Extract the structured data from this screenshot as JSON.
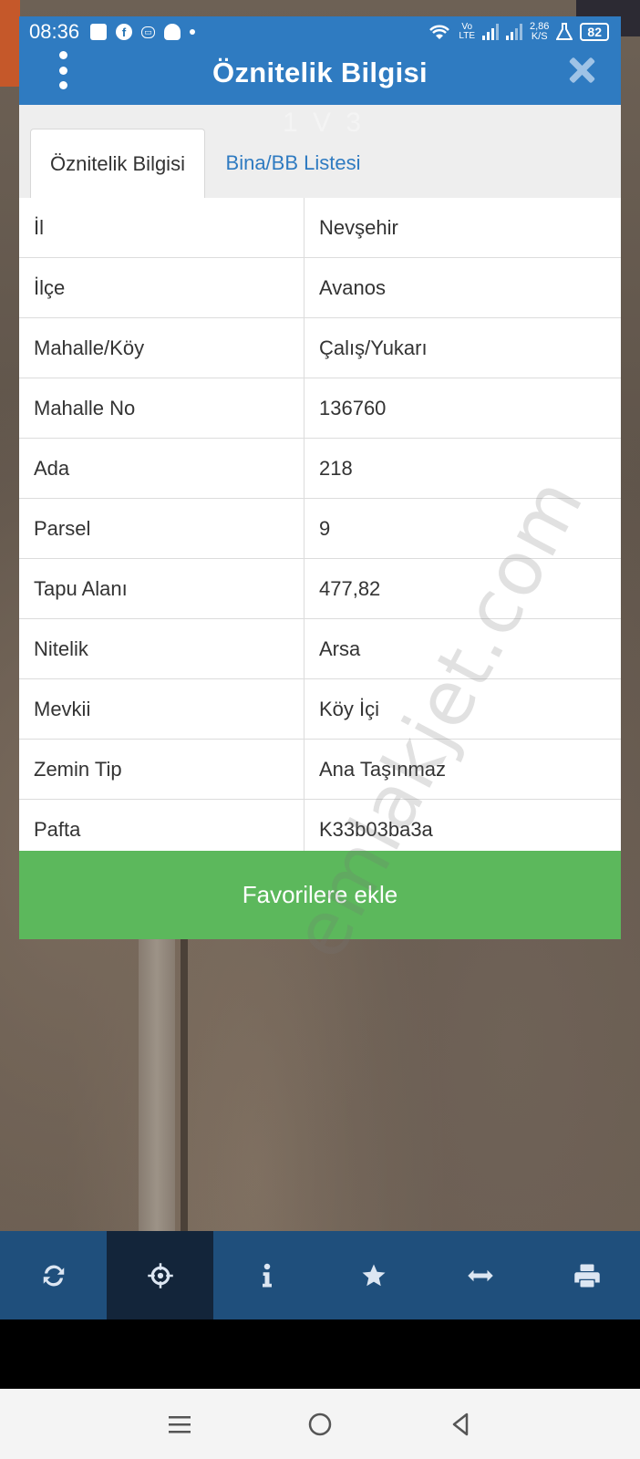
{
  "status_bar": {
    "time": "08:36",
    "volte": "Vo\nLTE",
    "speed": "2,86\nK/S",
    "battery": "82"
  },
  "dialog": {
    "title": "Öznitelik Bilgisi",
    "tabs": [
      {
        "label": "Öznitelik Bilgisi",
        "active": true
      },
      {
        "label": "Bina/BB Listesi",
        "active": false
      }
    ],
    "rows": [
      {
        "key": "İl",
        "value": "Nevşehir"
      },
      {
        "key": "İlçe",
        "value": "Avanos"
      },
      {
        "key": "Mahalle/Köy",
        "value": "Çalış/Yukarı"
      },
      {
        "key": "Mahalle No",
        "value": "136760"
      },
      {
        "key": "Ada",
        "value": "218"
      },
      {
        "key": "Parsel",
        "value": "9"
      },
      {
        "key": "Tapu Alanı",
        "value": "477,82"
      },
      {
        "key": "Nitelik",
        "value": "Arsa"
      },
      {
        "key": "Mevkii",
        "value": "Köy İçi"
      },
      {
        "key": "Zemin Tip",
        "value": "Ana Taşınmaz"
      },
      {
        "key": "Pafta",
        "value": "K33b03ba3a"
      }
    ],
    "favorite_button": "Favorilere ekle"
  },
  "watermark": "emlakjet.com",
  "watermark_top": "1 V 3",
  "toolbar": {
    "items": [
      "refresh-icon",
      "crosshair-icon",
      "info-icon",
      "star-icon",
      "arrows-horizontal-icon",
      "print-icon"
    ],
    "active": "crosshair-icon"
  },
  "colors": {
    "header": "#2f7bc1",
    "favorite": "#5cb85c",
    "toolbar": "#1f4f7c"
  }
}
